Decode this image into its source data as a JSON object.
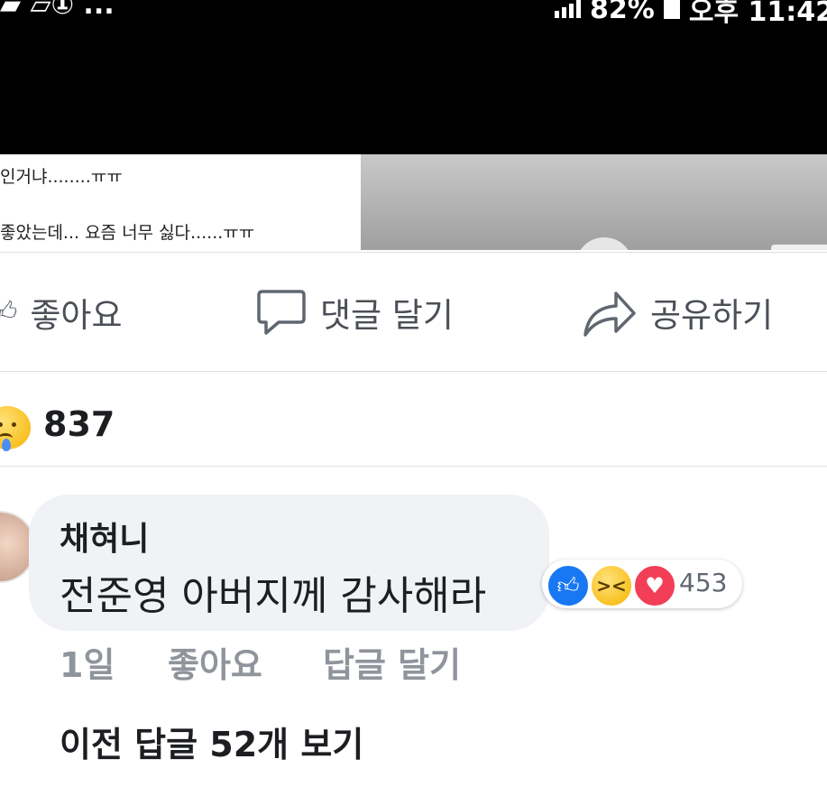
{
  "status_bar": {
    "left_text": "▰ ▱① ...",
    "right_text": "82%",
    "time": "오후 11:42"
  },
  "post": {
    "line1": "인거냐........ㅠㅠ",
    "line2": "좋았는데... 요즘 너무 싫다......ㅠㅠ"
  },
  "actions": {
    "like_label": "좋아요",
    "comment_label": "댓글 달기",
    "share_label": "공유하기"
  },
  "reactions": {
    "count": "837"
  },
  "comment": {
    "author": "채혀니",
    "text": "전준영 아버지께 감사해라",
    "reaction_count": "453",
    "age": "1일",
    "like_label": "좋아요",
    "reply_label": "답글 달기"
  },
  "view_previous_replies": "이전 답글 52개 보기"
}
